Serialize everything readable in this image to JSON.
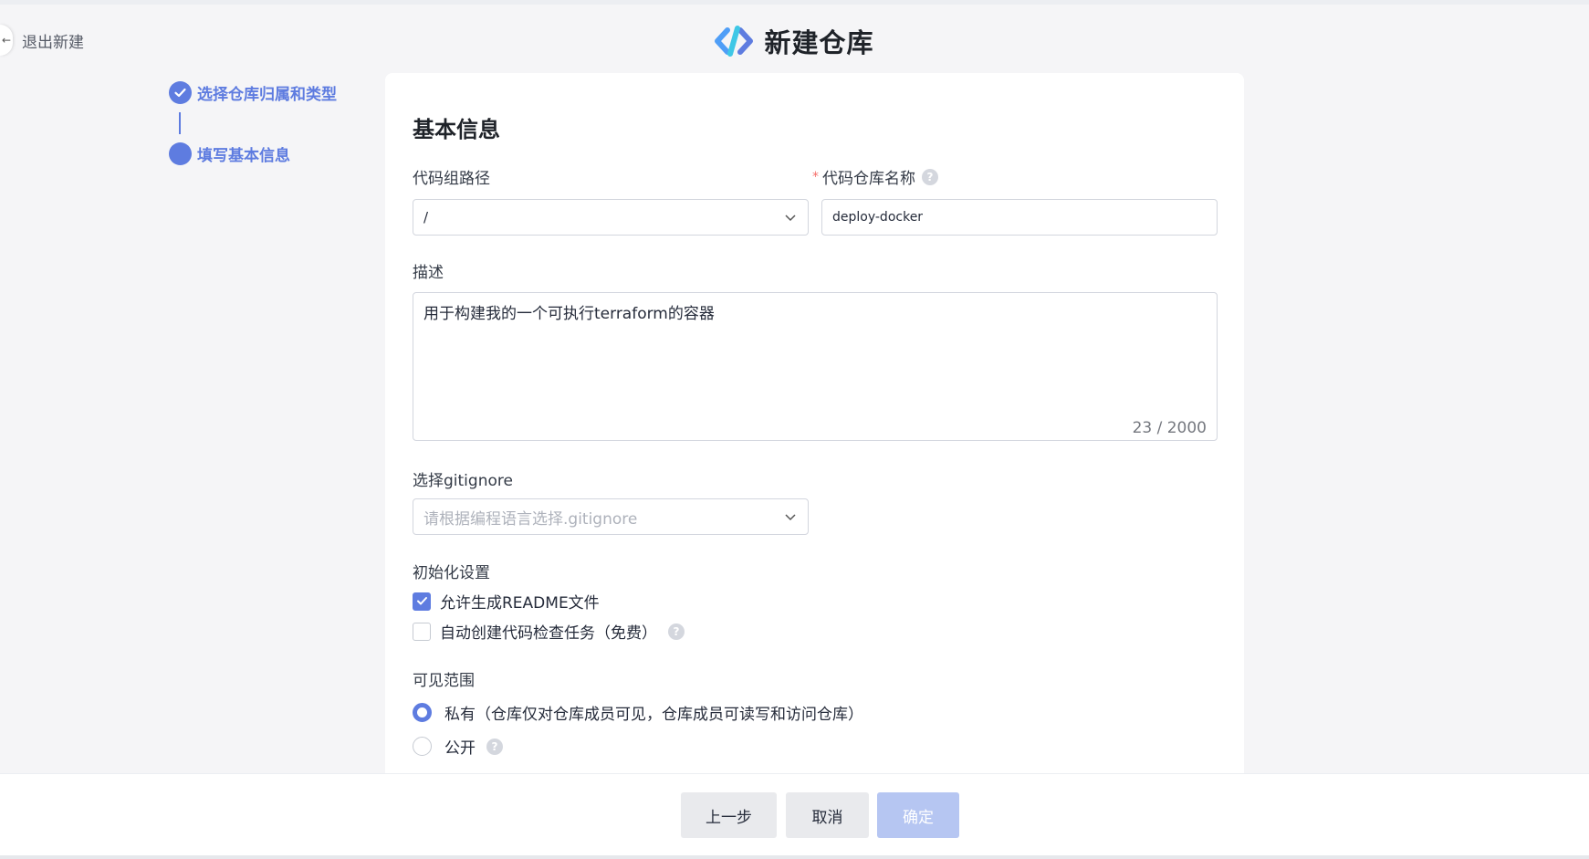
{
  "nav": {
    "exit_label": "退出新建"
  },
  "header": {
    "title": "新建仓库"
  },
  "steps": [
    {
      "label": "选择仓库归属和类型",
      "state": "done"
    },
    {
      "label": "填写基本信息",
      "state": "current"
    }
  ],
  "form": {
    "section_title": "基本信息",
    "group_path": {
      "label": "代码组路径",
      "value": "/"
    },
    "repo_name": {
      "label": "代码仓库名称",
      "required_mark": "*",
      "value": "deploy-docker"
    },
    "description": {
      "label": "描述",
      "value": "用于构建我的一个可执行terraform的容器",
      "counter": "23 / 2000"
    },
    "gitignore": {
      "label": "选择gitignore",
      "placeholder": "请根据编程语言选择.gitignore"
    },
    "init": {
      "label": "初始化设置",
      "options": [
        {
          "label": "允许生成README文件",
          "checked": true
        },
        {
          "label": "自动创建代码检查任务（免费）",
          "checked": false
        }
      ]
    },
    "visibility": {
      "label": "可见范围",
      "options": [
        {
          "label": "私有（仓库仅对仓库成员可见，仓库成员可读写和访问仓库）",
          "selected": true
        },
        {
          "label": "公开",
          "selected": false
        }
      ]
    }
  },
  "footer": {
    "prev_label": "上一步",
    "cancel_label": "取消",
    "confirm_label": "确定"
  },
  "colors": {
    "accent": "#5e7ce0",
    "confirm_disabled": "#b6c6f2",
    "required": "#f66f6a"
  }
}
